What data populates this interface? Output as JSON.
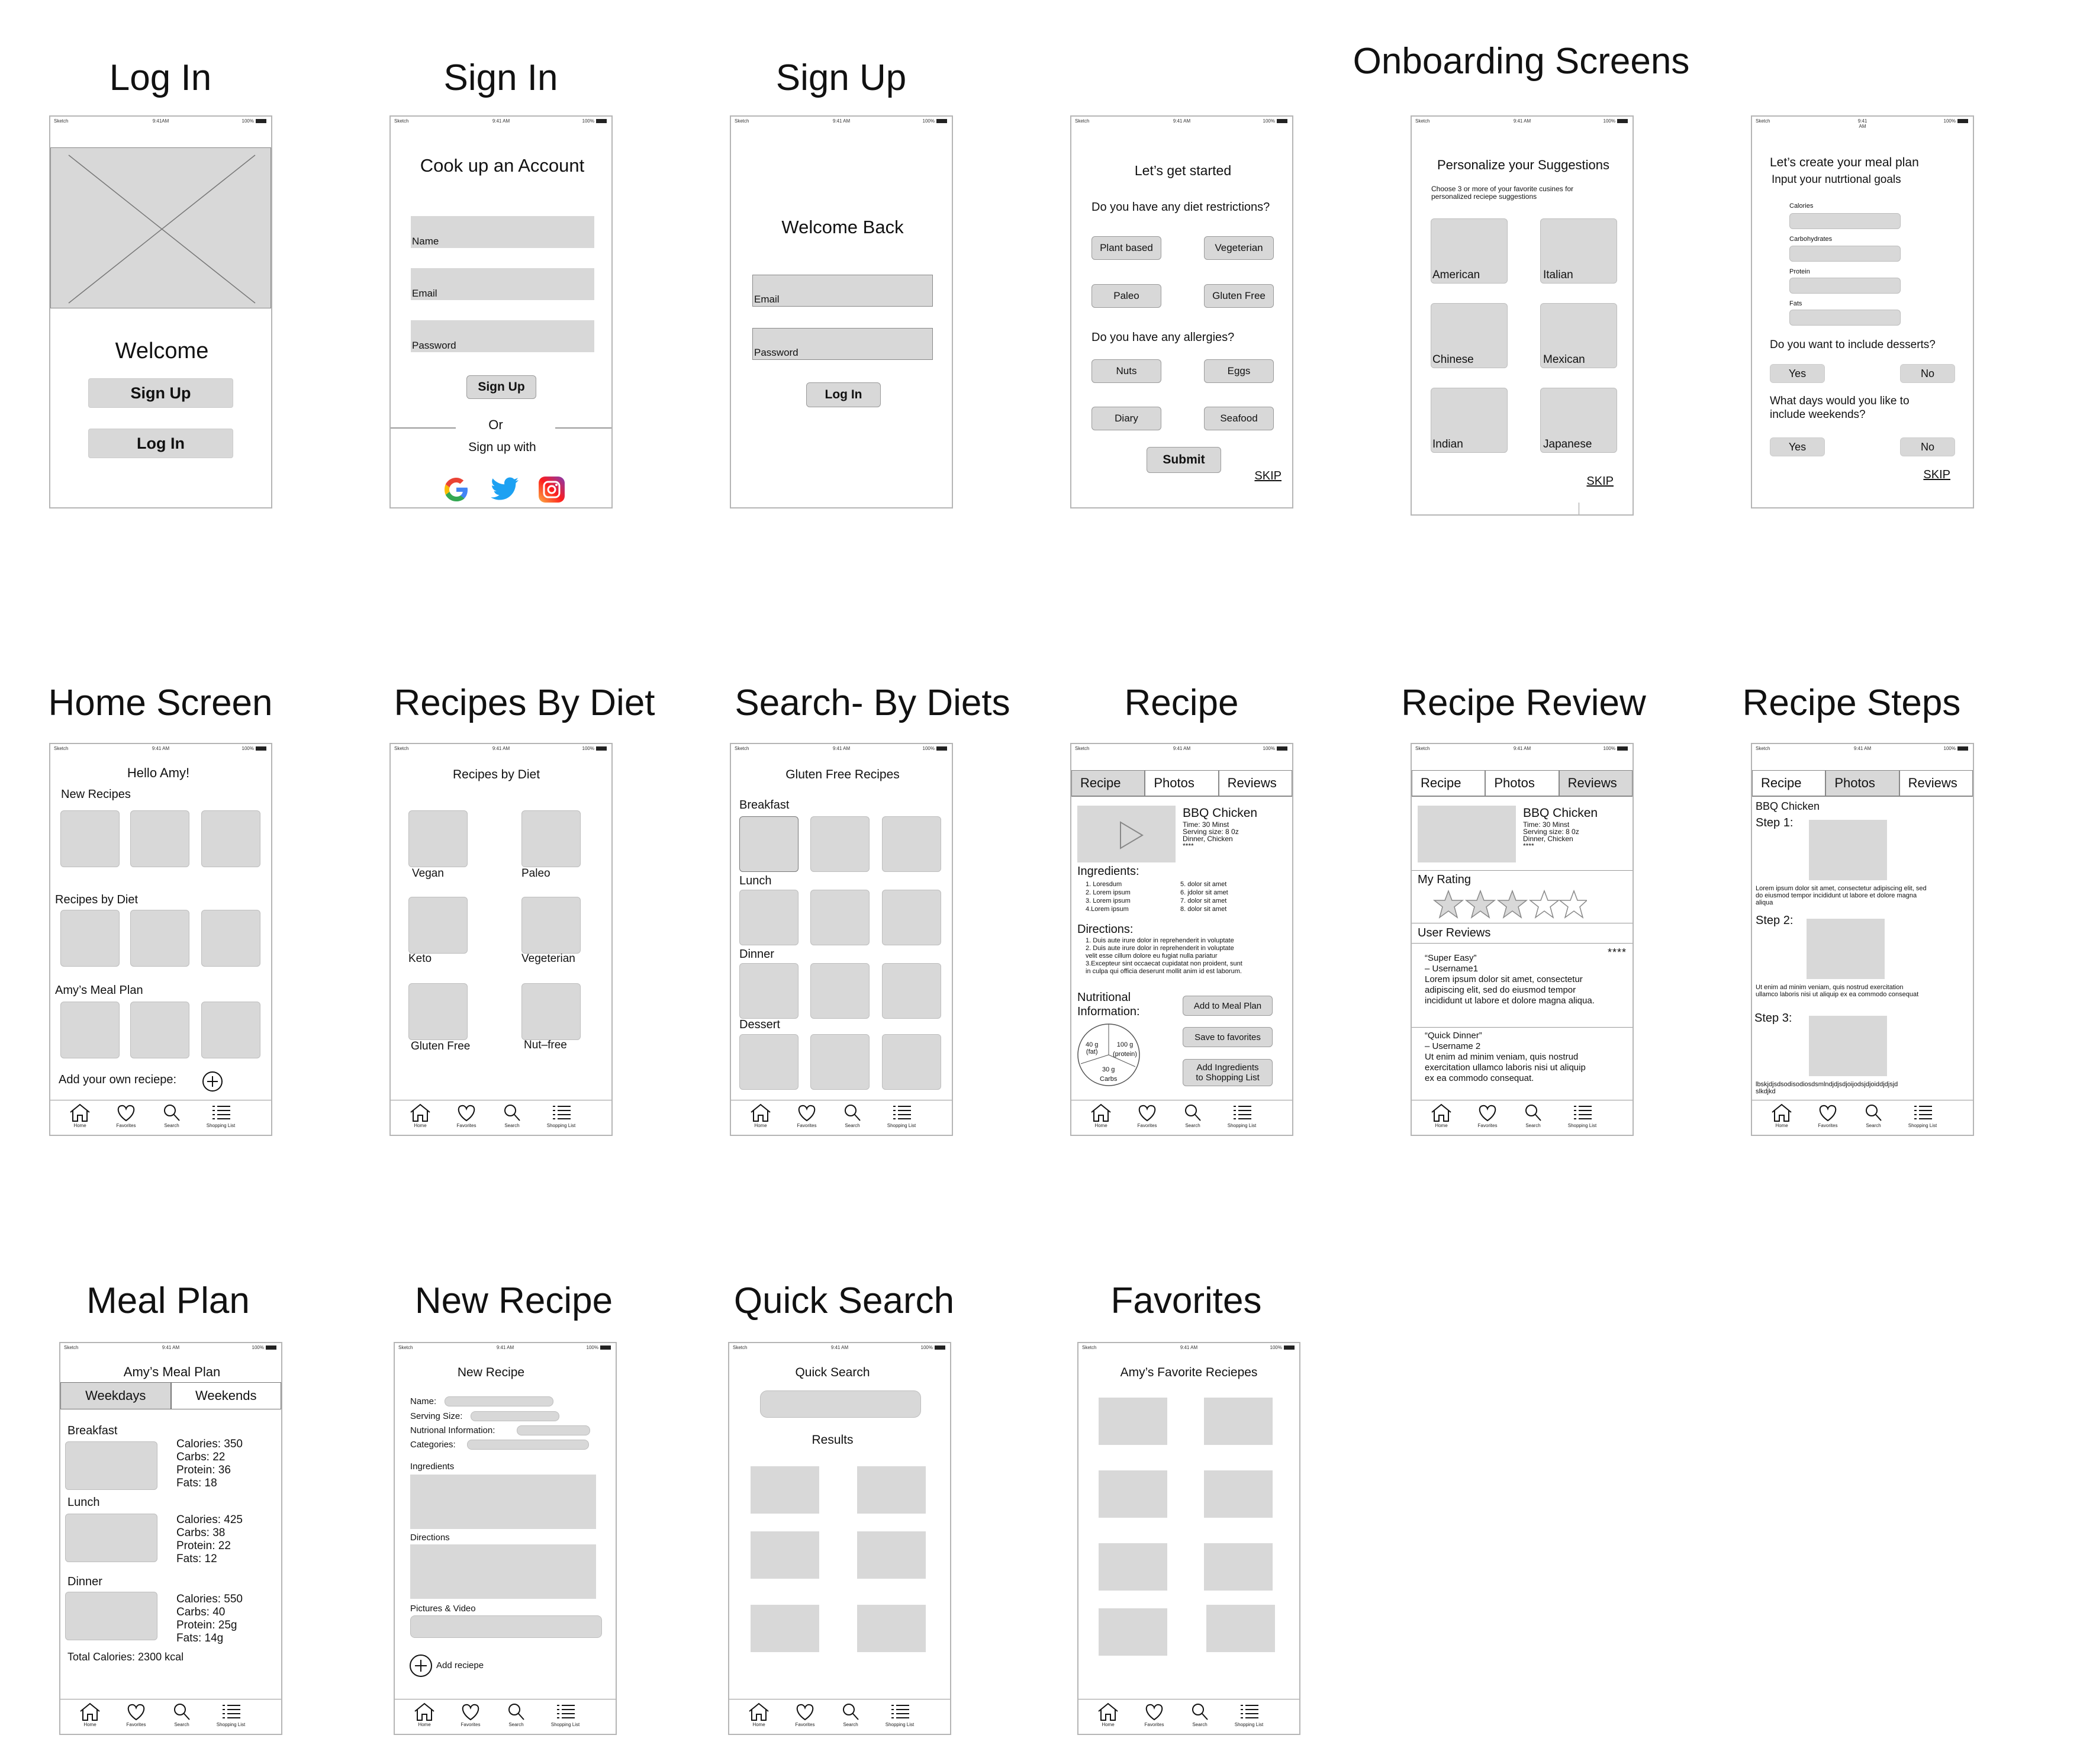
{
  "status_bar": {
    "carrier": "Sketch",
    "time": "9:41 AM",
    "time_alt": "9:41AM",
    "battery": "100%"
  },
  "titles": {
    "login": "Log In",
    "signin": "Sign In",
    "signup": "Sign Up",
    "onboarding": "Onboarding  Screens",
    "home": "Home Screen",
    "by_diet": "Recipes By Diet",
    "search_diets": "Search- By Diets",
    "recipe": "Recipe",
    "review": "Recipe Review",
    "steps": "Recipe Steps",
    "meal_plan": "Meal Plan",
    "new_recipe": "New Recipe",
    "quick_search": "Quick Search",
    "favorites": "Favorites"
  },
  "tab_bar": {
    "home": "Home",
    "favorites": "Favorites",
    "search": "Search",
    "shopping": "Shopping List"
  },
  "login": {
    "welcome": "Welcome",
    "signup": "Sign Up",
    "login": "Log In"
  },
  "signin": {
    "heading": "Cook up an Account",
    "name": "Name",
    "email": "Email",
    "password": "Password",
    "button": "Sign Up",
    "or": "Or",
    "signup_with": "Sign up with"
  },
  "signup": {
    "heading": "Welcome Back",
    "email": "Email",
    "password": "Password",
    "button": "Log In"
  },
  "onb1": {
    "heading": "Let’s get started",
    "q1": "Do you have any diet restrictions?",
    "diets": [
      "Plant based",
      "Vegeterian",
      "Paleo",
      "Gluten Free"
    ],
    "q2": "Do you have any allergies?",
    "allergies": [
      "Nuts",
      "Eggs",
      "Diary",
      "Seafood"
    ],
    "submit": "Submit",
    "skip": "SKIP"
  },
  "onb2": {
    "heading": "Personalize your Suggestions",
    "sub": "Choose 3 or more of your favorite cusines for personalized reciepe suggestions",
    "cuisines": [
      "American",
      "Italian",
      "Chinese",
      "Mexican",
      "Indian",
      "Japanese"
    ],
    "skip": "SKIP"
  },
  "onb3": {
    "time_top": "9:41",
    "time_bot": "AM",
    "heading": "Let’s create your meal plan",
    "sub": "Input your nutrtional goals",
    "fields": [
      "Calories",
      "Carbohydrates",
      "Protein",
      "Fats"
    ],
    "q1": "Do you want to include desserts?",
    "yes": "Yes",
    "no": "No",
    "q2a": "What days would you like to",
    "q2b": "include weekends?",
    "skip": "SKIP"
  },
  "home": {
    "greeting": "Hello Amy!",
    "new_recipes": "New Recipes",
    "by_diet": "Recipes by Diet",
    "meal_plan": "Amy’s Meal Plan",
    "add": "Add your own reciepe:"
  },
  "by_diet": {
    "heading": "Recipes by Diet",
    "items": [
      "Vegan",
      "Paleo",
      "Keto",
      "Vegeterian",
      "Gluten Free",
      "Nut–free"
    ]
  },
  "search_diets": {
    "heading": "Gluten Free Recipes",
    "rows": [
      "Breakfast",
      "Lunch",
      "Dinner",
      "Dessert"
    ]
  },
  "recipe": {
    "tabs": [
      "Recipe",
      "Photos",
      "Reviews"
    ],
    "name": "BBQ Chicken",
    "meta": [
      "Time: 30 Minst",
      "Serving size: 8 0z",
      "Dinner, Chicken",
      "****"
    ],
    "ingredients_label": "Ingredients:",
    "ing_left": [
      "1. Loresdum",
      "2. Lorem ipsum",
      "3. Lorem ipsum",
      "4.Lorem ipsum"
    ],
    "ing_right": [
      "5. dolor sit amet",
      "6. jdolor sit amet",
      "7. dolor sit amet",
      "8. dolor sit amet"
    ],
    "directions_label": "Directions:",
    "directions": [
      "1. Duis aute irure dolor in reprehenderit in voluptate",
      "2. Duis aute irure dolor in reprehenderit in voluptate",
      "velit esse cillum dolore eu fugiat nulla pariatur",
      "3.Excepteur sint occaecat cupidatat non proident, sunt",
      "in culpa qui officia deserunt mollit anim id est laborum."
    ],
    "nutrition_a": "Nutritional",
    "nutrition_b": "Information:",
    "pie": [
      "40 g",
      "(fat)",
      "100 g",
      "(protein)",
      "30 g",
      "Carbs"
    ],
    "add_meal": "Add to Meal Plan",
    "save_fav": "Save to favorites",
    "add_ing_a": "Add Ingredients",
    "add_ing_b": "to Shopping List"
  },
  "review": {
    "tabs": [
      "Recipe",
      "Photos",
      "Reviews"
    ],
    "name": "BBQ Chicken",
    "meta": [
      "Time: 30 Minst",
      "Serving size: 8 0z",
      "Dinner, Chicken",
      "****"
    ],
    "my_rating": "My Rating",
    "user_reviews": "User Reviews",
    "stars": "****",
    "r1": [
      "“Super Easy”",
      "– Username1",
      "Lorem ipsum dolor sit amet, consectetur",
      "adipiscing elit, sed do eiusmod tempor",
      "incididunt ut labore et dolore magna aliqua."
    ],
    "r2": [
      "“Quick Dinner”",
      "– Username 2",
      "Ut enim ad minim veniam, quis nostrud",
      "exercitation ullamco laboris nisi ut aliquip",
      "ex ea commodo consequat."
    ]
  },
  "steps": {
    "tabs": [
      "Recipe",
      "Photos",
      "Reviews"
    ],
    "name": "BBQ Chicken",
    "step1": "Step 1:",
    "step2": "Step 2:",
    "step3": "Step 3:",
    "text1": [
      "Lorem ipsum dolor sit amet, consectetur adipiscing elit, sed",
      "do eiusmod tempor incididunt ut labore et dolore magna",
      "aliqua"
    ],
    "text2": [
      "Ut enim ad minim veniam, quis nostrud exercitation",
      "ullamco laboris nisi ut aliquip ex ea commodo consequat"
    ],
    "text3": [
      "lbskjdjsdsodisodiosdsmlndjdjsdjoijodsjdjoiddjdjsjd",
      "slkdjkd"
    ]
  },
  "meal_plan": {
    "heading": "Amy’s Meal Plan",
    "tabs": [
      "Weekdays",
      "Weekends"
    ],
    "meals": [
      {
        "name": "Breakfast",
        "lines": [
          "Calories: 350",
          "Carbs: 22",
          "Protein: 36",
          "Fats: 18"
        ]
      },
      {
        "name": "Lunch",
        "lines": [
          "Calories: 425",
          "Carbs: 38",
          "Protein: 22",
          "Fats: 12"
        ]
      },
      {
        "name": "Dinner",
        "lines": [
          "Calories: 550",
          "Carbs: 40",
          "Protein: 25g",
          "Fats: 14g"
        ]
      }
    ],
    "total": "Total Calories: 2300 kcal"
  },
  "new_recipe": {
    "heading": "New Recipe",
    "name": "Name:",
    "serving": "Serving Size:",
    "nutrition": "Nutrional Information:",
    "categories": "Categories:",
    "ingredients": "Ingredients",
    "directions": "Directions",
    "media": "Pictures & Video",
    "add": "Add reciepe"
  },
  "quick_search": {
    "heading": "Quick Search",
    "results": "Results"
  },
  "favorites": {
    "heading": "Amy’s Favorite Reciepes"
  }
}
